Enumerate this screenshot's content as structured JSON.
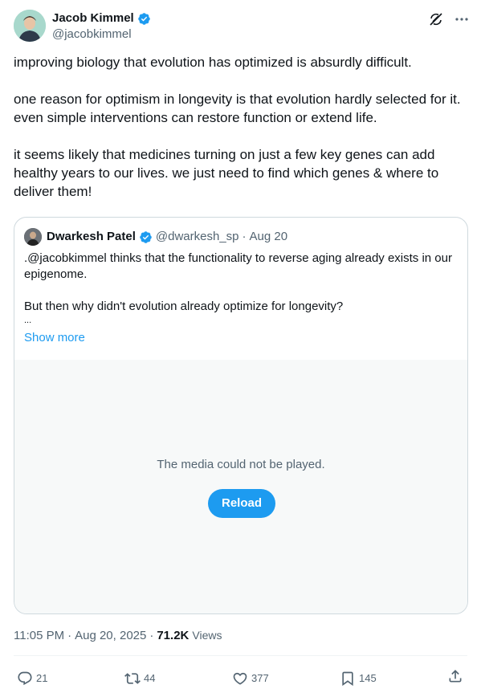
{
  "author": {
    "name": "Jacob Kimmel",
    "handle": "@jacobkimmel",
    "verified": true
  },
  "tweet": {
    "paragraphs": [
      "improving biology that evolution has optimized is absurdly difficult.",
      "one reason for optimism in longevity is that evolution hardly selected for it. even simple interventions can restore function or extend life.",
      "it seems likely that medicines turning on just a few key genes can add healthy years to our lives. we just need to find which genes & where to deliver them!"
    ]
  },
  "quote": {
    "name": "Dwarkesh Patel",
    "handle": "@dwarkesh_sp",
    "separator": "·",
    "date": "Aug 20",
    "line1": ".@jacobkimmel thinks that the functionality to reverse aging already exists in our epigenome.",
    "line2": "But then why didn't evolution already optimize for longevity?",
    "ellipsis": "...",
    "show_more": "Show more",
    "media": {
      "message": "The media could not be played.",
      "reload_label": "Reload"
    }
  },
  "meta": {
    "time": "11:05 PM",
    "separator1": "·",
    "date": "Aug 20, 2025",
    "separator2": "·",
    "views_count": "71.2K",
    "views_label": "Views"
  },
  "actions": {
    "replies": "21",
    "reposts": "44",
    "likes": "377",
    "bookmarks": "145"
  },
  "colors": {
    "accent": "#1d9bf0",
    "text_secondary": "#536471",
    "border": "#cfd9de"
  },
  "icons": [
    "verified-badge-icon",
    "grok-icon",
    "more-icon",
    "reply-icon",
    "repost-icon",
    "like-icon",
    "bookmark-icon",
    "share-icon"
  ]
}
